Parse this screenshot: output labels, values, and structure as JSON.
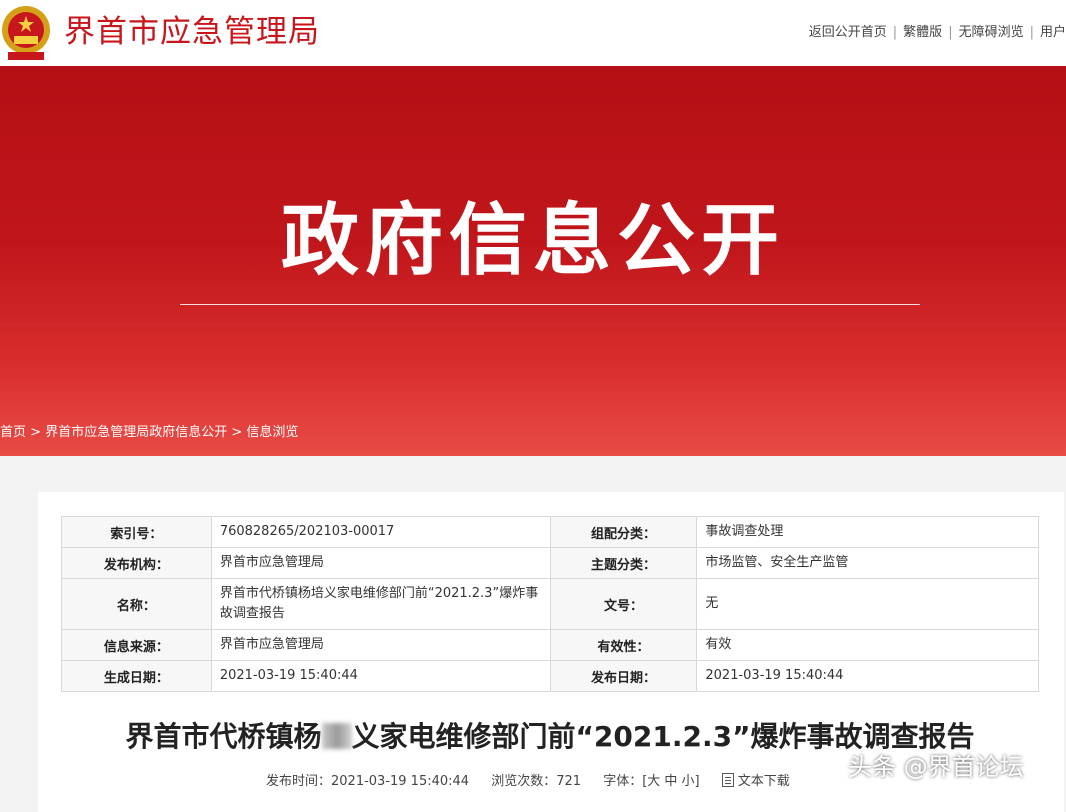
{
  "header": {
    "site_title": "界首市应急管理局",
    "links": [
      "返回公开首页",
      "繁體版",
      "无障碍浏览",
      "用户"
    ]
  },
  "banner": {
    "title": "政府信息公开",
    "breadcrumb": [
      "首页",
      "界首市应急管理局政府信息公开",
      "信息浏览"
    ],
    "breadcrumb_sep": ">"
  },
  "meta": {
    "index_label": "索引号：",
    "index_value": "760828265/202103-00017",
    "category_label": "组配分类：",
    "category_value": "事故调查处理",
    "publisher_label": "发布机构：",
    "publisher_value": "界首市应急管理局",
    "topic_label": "主题分类：",
    "topic_value": "市场监管、安全生产监管",
    "name_label": "名称：",
    "name_value": "界首市代桥镇杨培义家电维修部门前“2021.2.3”爆炸事故调查报告",
    "docno_label": "文号：",
    "docno_value": "无",
    "source_label": "信息来源：",
    "source_value": "界首市应急管理局",
    "validity_label": "有效性：",
    "validity_value": "有效",
    "created_label": "生成日期：",
    "created_value": "2021-03-19 15:40:44",
    "published_label": "发布日期：",
    "published_value": "2021-03-19 15:40:44"
  },
  "article": {
    "title_part1": "界首市代桥镇杨",
    "title_part2": "义家电维修部门前“2021.2.3”爆炸事故调查报告",
    "publish_time": "发布时间：2021-03-19 15:40:44",
    "views": "浏览次数：721",
    "font_size": "字体：[大 中 小]",
    "download": "文本下载"
  },
  "watermark": "头条 @界首论坛",
  "colors": {
    "brand_red": "#c8161d",
    "banner_red": "#c0161b"
  }
}
